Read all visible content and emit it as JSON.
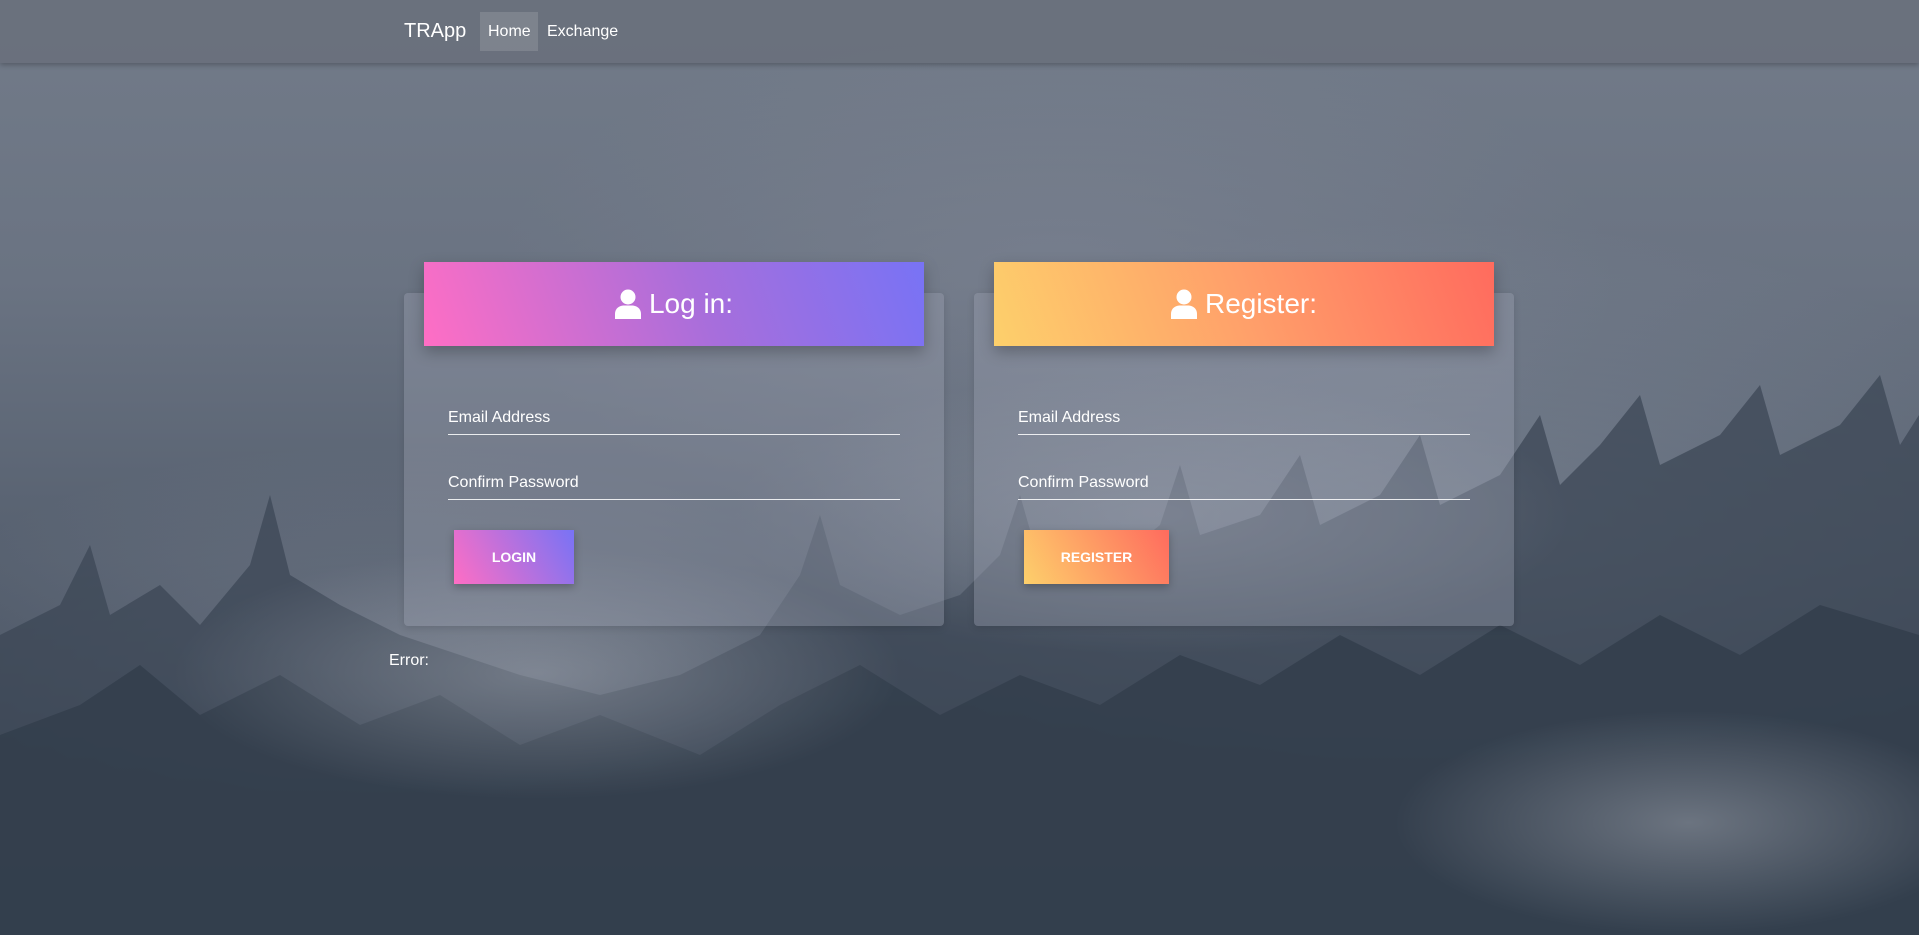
{
  "navbar": {
    "brand": "TRApp",
    "items": [
      {
        "label": "Home",
        "active": true
      },
      {
        "label": "Exchange",
        "active": false
      }
    ]
  },
  "login": {
    "title": "Log in:",
    "email_placeholder": "Email Address",
    "password_placeholder": "Confirm Password",
    "button_label": "LOGIN",
    "icon": "user-icon"
  },
  "register": {
    "title": "Register:",
    "email_placeholder": "Email Address",
    "password_placeholder": "Confirm Password",
    "button_label": "REGISTER",
    "icon": "user-icon"
  },
  "error": {
    "label": "Error:"
  },
  "colors": {
    "login_gradient": [
      "#ff6ec4",
      "#7873f5"
    ],
    "register_gradient": [
      "#fdd06b",
      "#ff6b5e"
    ]
  }
}
